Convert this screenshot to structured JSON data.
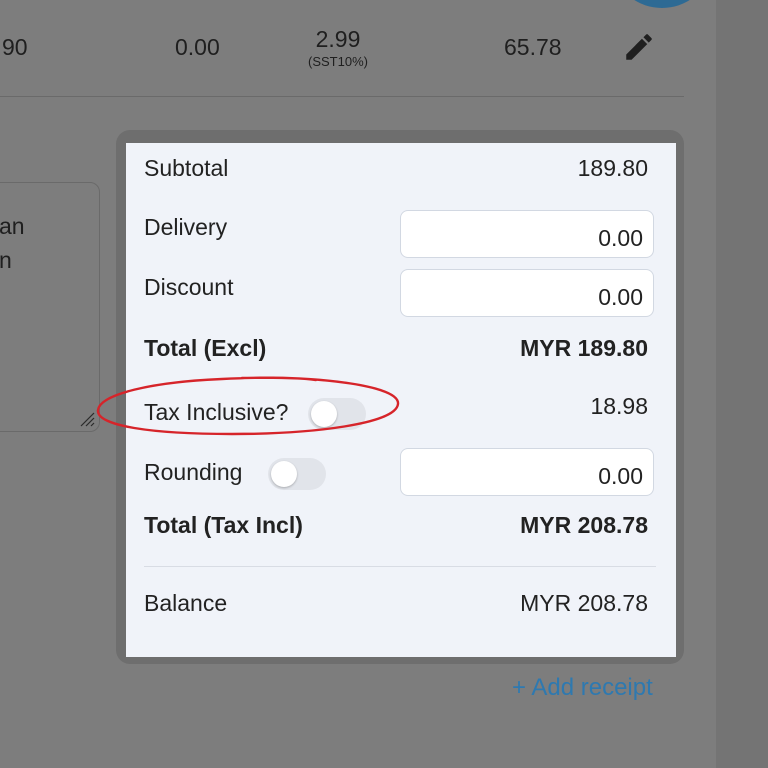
{
  "line_item": {
    "first_partial": "90",
    "discount": "0.00",
    "tax_amount": "2.99",
    "tax_code": "(SST10%)",
    "line_total": "65.78"
  },
  "textarea_partial": [
    "an",
    "n"
  ],
  "summary": {
    "subtotal_label": "Subtotal",
    "subtotal_value": "189.80",
    "delivery_label": "Delivery",
    "delivery_value": "0.00",
    "discount_label": "Discount",
    "discount_value": "0.00",
    "total_excl_label": "Total (Excl)",
    "total_excl_value": "MYR 189.80",
    "tax_inclusive_label": "Tax Inclusive?",
    "tax_inclusive_on": false,
    "tax_value": "18.98",
    "rounding_label": "Rounding",
    "rounding_on": false,
    "rounding_value": "0.00",
    "total_incl_label": "Total (Tax Incl)",
    "total_incl_value": "MYR 208.78",
    "balance_label": "Balance",
    "balance_value": "MYR 208.78"
  },
  "add_receipt_label": "+ Add receipt",
  "icons": {
    "edit": "pencil-icon",
    "resize": "resize-grip-icon"
  },
  "colors": {
    "accent": "#2e79b0",
    "highlight_ring": "#d6242a",
    "panel_bg": "#f0f3f9"
  }
}
